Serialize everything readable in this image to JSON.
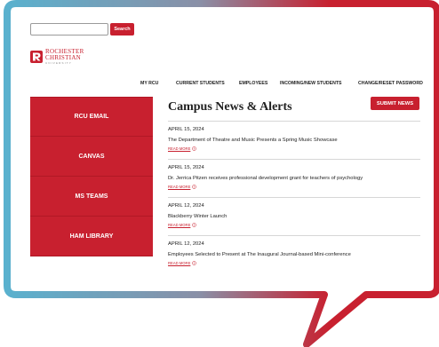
{
  "colors": {
    "accent": "#c8202f",
    "frame_blue": "#5ab1ce",
    "frame_red": "#c8202f"
  },
  "search": {
    "placeholder": "",
    "button_label": "Search"
  },
  "logo": {
    "line1": "ROCHESTER",
    "line2": "CHRISTIAN",
    "line3": "UNIVERSITY"
  },
  "nav": {
    "items": [
      "MY RCU",
      "CURRENT STUDENTS",
      "EMPLOYEES",
      "INCOMING/NEW STUDENTS",
      "CHANGE/RESET PASSWORD"
    ]
  },
  "sidebar": {
    "items": [
      "RCU EMAIL",
      "CANVAS",
      "MS TEAMS",
      "HAM LIBRARY"
    ]
  },
  "news": {
    "title": "Campus News & Alerts",
    "submit_label": "SUBMIT NEWS",
    "read_more_label": "READ MORE",
    "items": [
      {
        "date": "APRIL 15, 2024",
        "headline": "The Department of Theatre and Music Presents a Spring Music Showcase"
      },
      {
        "date": "APRIL 15, 2024",
        "headline": "Dr. Jerrica Pitzen receives professional development grant for teachers of psychology"
      },
      {
        "date": "APRIL 12, 2024",
        "headline": "Blackberry Winter Launch"
      },
      {
        "date": "APRIL 12, 2024",
        "headline": "Employees Selected to Present at The Inaugural Journal-based Mini-conference"
      }
    ]
  }
}
